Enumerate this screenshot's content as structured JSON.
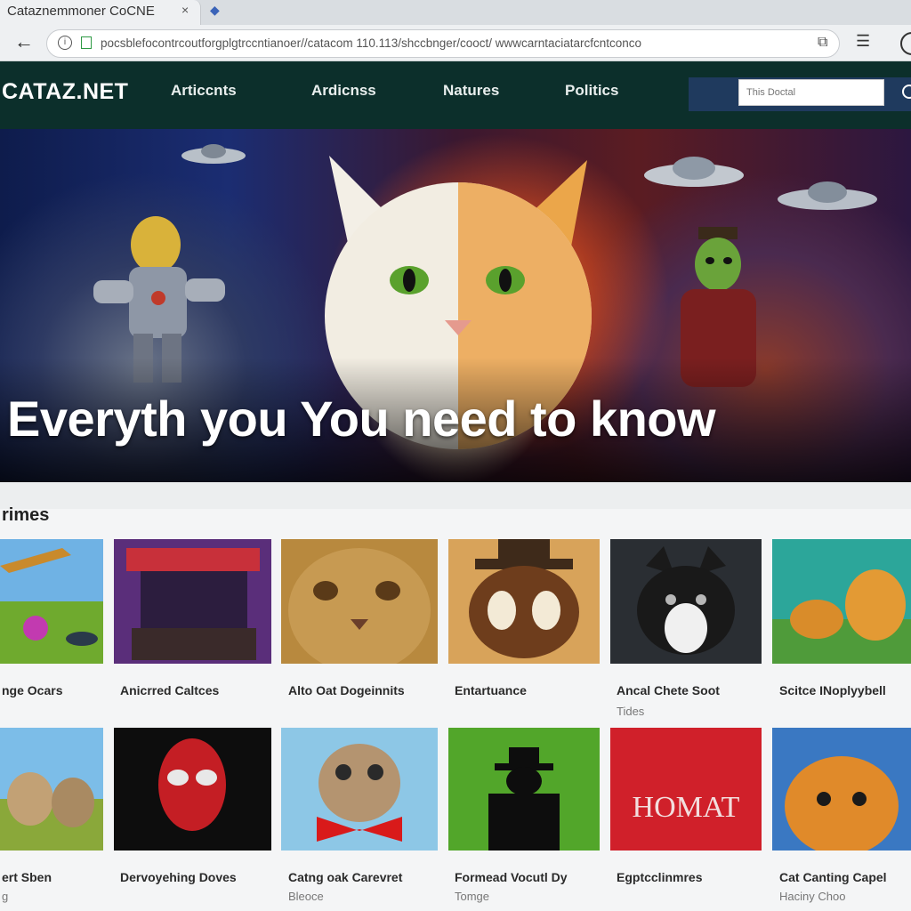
{
  "browser": {
    "tab_title": "Cataznemmoner CoCNE",
    "tab_close": "×",
    "url": "pocsblefocontrcoutforgplgtrccntianoer//catacom 110.113/shccbnger/cooct/ wwwcarntaciatarcfcntconco",
    "menu_glyph": "☰"
  },
  "site": {
    "logo": "CATAZ.NET",
    "nav": [
      "Articcnts",
      "Ardicnss",
      "Natures",
      "Politics"
    ],
    "search_placeholder": "This Doctal"
  },
  "hero": {
    "title": "Everyth you You need to know"
  },
  "section": {
    "title": "rimes"
  },
  "cards_row1": [
    {
      "title": "nge Ocars",
      "sub": ""
    },
    {
      "title": "Anicrred Caltces",
      "sub": ""
    },
    {
      "title": "Alto Oat Dogeinnits",
      "sub": ""
    },
    {
      "title": "Entartuance",
      "sub": ""
    },
    {
      "title": "Ancal Chete Soot",
      "sub": "Tides"
    },
    {
      "title": "Scitce INoplyybell",
      "sub": ""
    }
  ],
  "cards_row2": [
    {
      "title": "ert Sben",
      "sub": "g"
    },
    {
      "title": "Dervoyehing Doves",
      "sub": ""
    },
    {
      "title": "Catng oak Carevret",
      "sub": "Bleoce"
    },
    {
      "title": "Formead Vocutl Dy",
      "sub": "Tomge"
    },
    {
      "title": "Egptcclinmres",
      "sub": ""
    },
    {
      "title": "Cat Canting Capel",
      "sub": "Haciny Choo"
    }
  ],
  "thumb6_text": "HOMAT",
  "colors": {
    "header_bg": "#0c2f2b",
    "search_bg": "#1f3a5e",
    "page_bg": "#f4f5f6"
  }
}
